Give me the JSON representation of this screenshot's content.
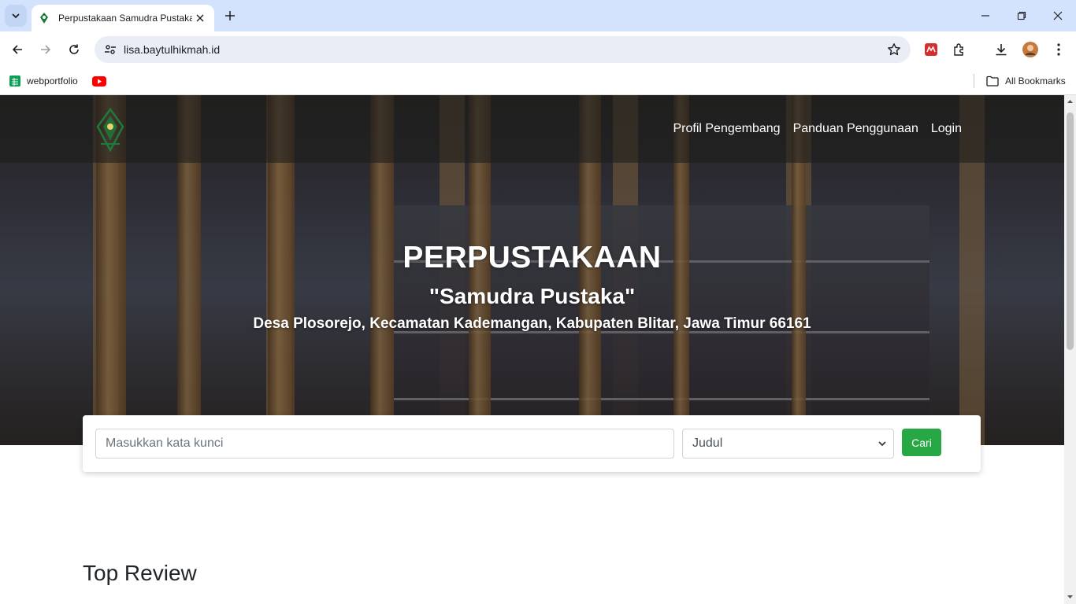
{
  "browser": {
    "tab_title": "Perpustakaan Samudra Pustaka",
    "url": "lisa.baytulhikmah.id",
    "bookmarks": [
      {
        "label": "webportfolio"
      },
      {
        "label": ""
      }
    ],
    "all_bookmarks_label": "All Bookmarks"
  },
  "site": {
    "nav": {
      "items": [
        "Profil Pengembang",
        "Panduan Penggunaan",
        "Login"
      ]
    },
    "hero": {
      "title": "PERPUSTAKAAN",
      "subtitle": "\"Samudra Pustaka\"",
      "address": "Desa Plosorejo, Kecamatan Kademangan, Kabupaten Blitar, Jawa Timur 66161"
    },
    "search": {
      "placeholder": "Masukkan kata kunci",
      "selected_option": "Judul",
      "button_label": "Cari"
    },
    "sections": {
      "top_review": "Top Review"
    }
  },
  "colors": {
    "tabbar": "#d3e3fd",
    "search_button": "#28a745",
    "logo_green": "#1e7a3c"
  }
}
